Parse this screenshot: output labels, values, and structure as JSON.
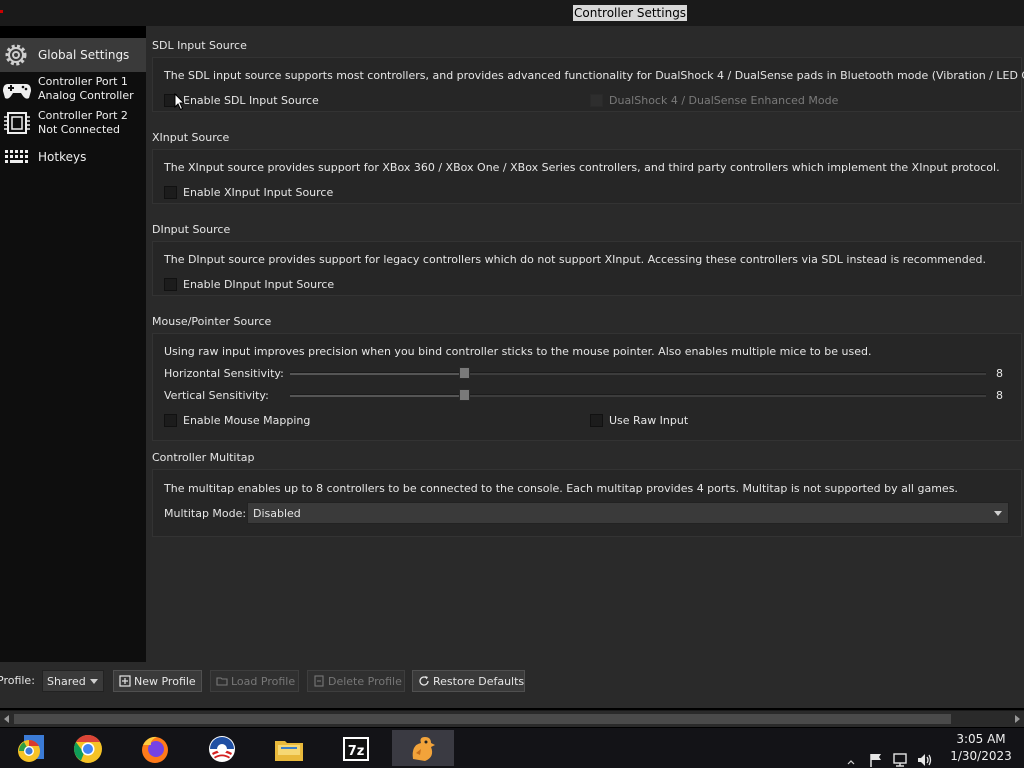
{
  "window": {
    "title": "Controller Settings"
  },
  "sidebar": {
    "items": [
      {
        "id": "global",
        "label": "Global Settings",
        "icon": "gear-icon",
        "selected": true
      },
      {
        "id": "port1",
        "line1": "Controller Port 1",
        "line2": "Analog Controller",
        "icon": "gamepad-icon"
      },
      {
        "id": "port2",
        "line1": "Controller Port 2",
        "line2": "Not Connected",
        "icon": "chip-icon"
      },
      {
        "id": "hotkeys",
        "label": "Hotkeys",
        "icon": "keyboard-icon"
      }
    ]
  },
  "sdl": {
    "title": "SDL Input Source",
    "description": "The SDL input source supports most controllers, and provides advanced functionality for DualShock 4 / DualSense pads in Bluetooth mode (Vibration / LED Control).",
    "enable_label": "Enable SDL Input Source",
    "enable_checked": false,
    "enhanced_label": "DualShock 4 / DualSense Enhanced Mode",
    "enhanced_checked": false,
    "enhanced_disabled": true
  },
  "xinput": {
    "title": "XInput Source",
    "description": "The XInput source provides support for XBox 360 / XBox One / XBox Series controllers, and third party controllers which implement the XInput protocol.",
    "enable_label": "Enable XInput Input Source",
    "enable_checked": false
  },
  "dinput": {
    "title": "DInput Source",
    "description": "The DInput source provides support for legacy controllers which do not support XInput. Accessing these controllers via SDL instead is recommended.",
    "enable_label": "Enable DInput Input Source",
    "enable_checked": false
  },
  "mouse": {
    "title": "Mouse/Pointer Source",
    "description": "Using raw input improves precision when you bind controller sticks to the mouse pointer. Also enables multiple mice to be used.",
    "horizontal_label": "Horizontal Sensitivity:",
    "horizontal_value": "8",
    "horizontal_fraction": 0.25,
    "vertical_label": "Vertical Sensitivity:",
    "vertical_value": "8",
    "vertical_fraction": 0.25,
    "mapping_label": "Enable Mouse Mapping",
    "mapping_checked": false,
    "raw_label": "Use Raw Input",
    "raw_checked": false
  },
  "multitap": {
    "title": "Controller Multitap",
    "description": "The multitap enables up to 8 controllers to be connected to the console. Each multitap provides 4 ports. Multitap is not supported by all games.",
    "mode_label": "Multitap Mode:",
    "mode_value": "Disabled"
  },
  "bottom": {
    "profile_label": "Profile:",
    "profile_value": "Shared",
    "new_profile": "New Profile",
    "load_profile": "Load Profile",
    "delete_profile": "Delete Profile",
    "restore_defaults": "Restore Defaults"
  },
  "taskbar": {
    "apps": [
      "chrome-canary-icon",
      "chrome-icon",
      "firefox-icon",
      "obama-logo-icon",
      "file-explorer-icon",
      "7zip-icon",
      "duckstation-icon"
    ],
    "zip_label": "7z",
    "time": "3:05 AM",
    "date": "1/30/2023"
  },
  "colors": {
    "panel": "#262626",
    "sidebar": "#0e0e0e",
    "selected": "#3a3a3a"
  }
}
